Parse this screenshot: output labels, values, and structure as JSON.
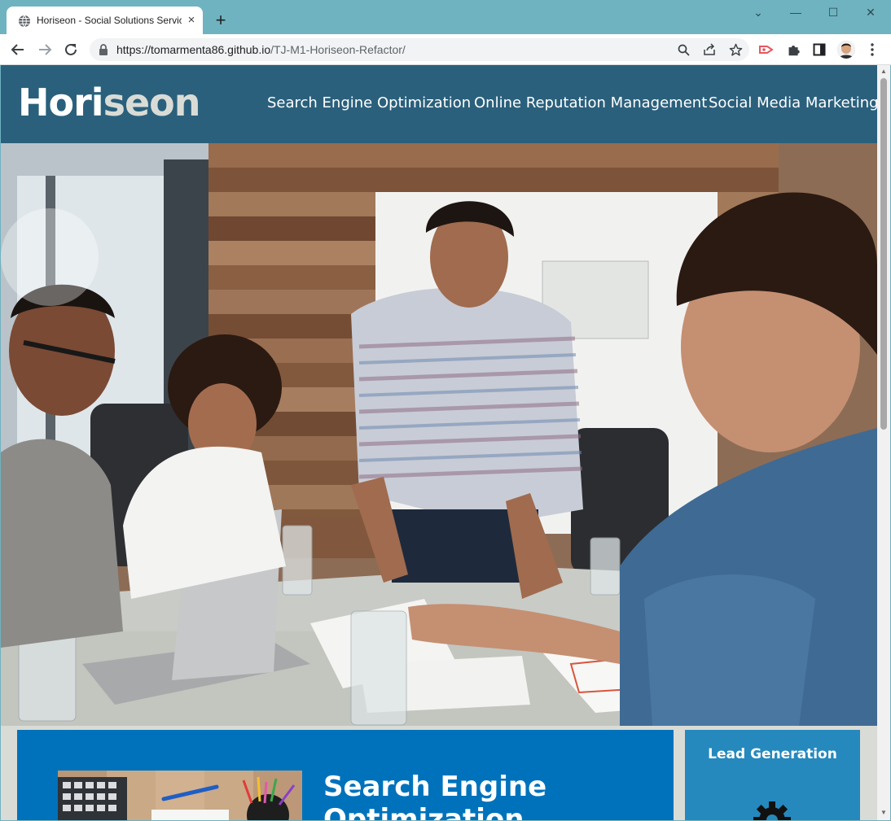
{
  "browser": {
    "tab_title": "Horiseon - Social Solutions Services",
    "tab_close": "×",
    "new_tab": "+",
    "url_host": "https://tomarmenta86.github.io",
    "url_path": "/TJ-M1-Horiseon-Refactor/",
    "window_controls": {
      "minimize": "—",
      "maximize": "☐",
      "close": "✕",
      "dropdown": "⌄"
    }
  },
  "site": {
    "logo_main": "Hori",
    "logo_accent": "seon",
    "nav": [
      "Search Engine Optimization",
      "Online Reputation Management",
      "Social Media Marketing"
    ]
  },
  "content": {
    "main_card_title": "Search Engine Optimization",
    "side_card_title": "Lead Generation"
  },
  "icons": {
    "favicon": "globe-icon",
    "lock": "lock-icon",
    "search": "search-icon",
    "share": "share-icon",
    "bookmark": "star-icon",
    "extension": "puzzle-icon",
    "sidepanel": "side-panel-icon",
    "menu": "kebab-menu-icon",
    "gear": "gear-icon"
  },
  "colors": {
    "header": "#2a607c",
    "main_card": "#0072bb",
    "side_card": "#2589bd",
    "page_bg": "#d9dcd6",
    "browser_frame": "#6fb3c0"
  }
}
